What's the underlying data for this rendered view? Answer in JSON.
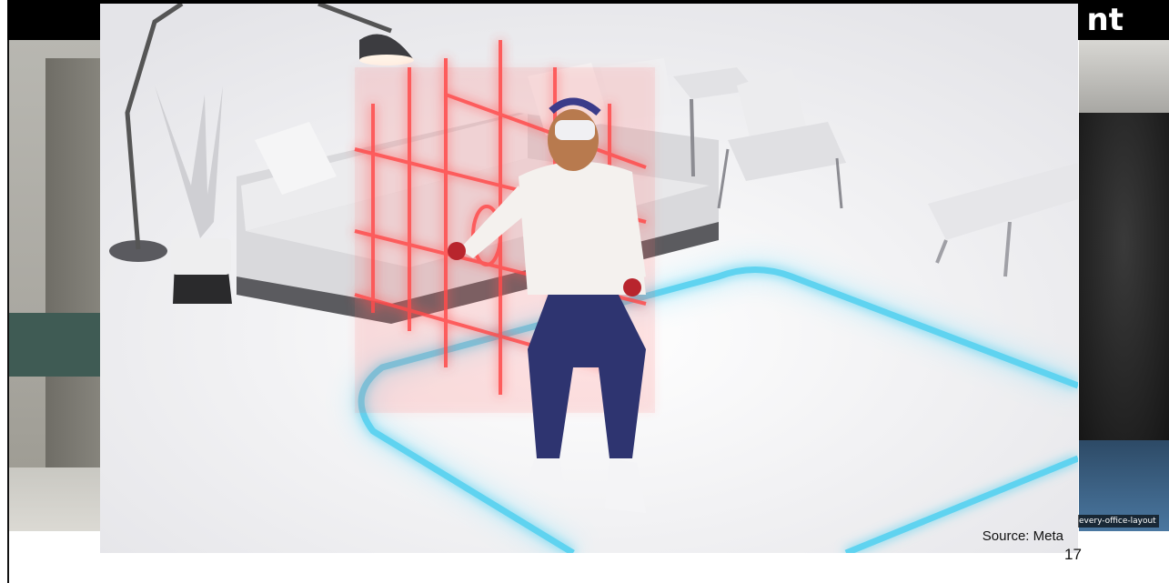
{
  "slide": {
    "title_fragment": "nt",
    "page_number": "17"
  },
  "main_image": {
    "subject": "Person wearing a VR headset inside a glowing guardian boundary with a virtual red grid wall near a sofa",
    "source": "Source: Meta"
  },
  "right_image": {
    "caption": "every-office-layout"
  },
  "colors": {
    "title_bar": "#000000",
    "boundary_glow": "#5fd3f0",
    "grid_wall": "#ff3b3b",
    "floor": "#f1f1f3",
    "furniture": "#e9e9eb"
  }
}
